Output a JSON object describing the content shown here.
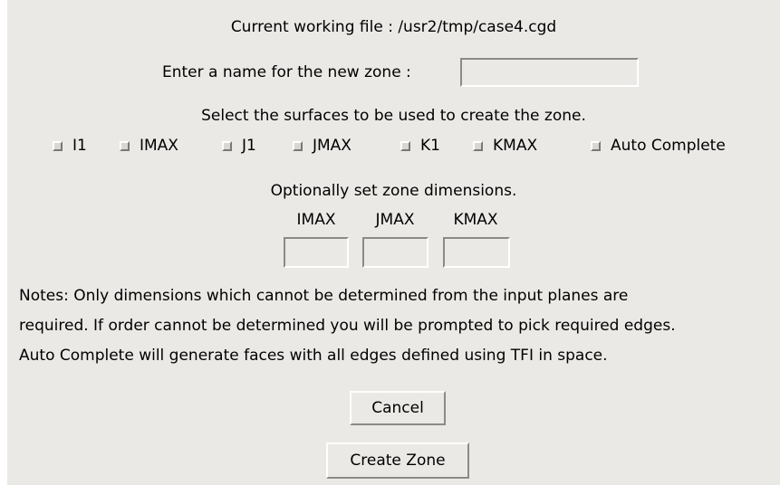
{
  "working_file": {
    "text": "Current working file : /usr2/tmp/case4.cgd"
  },
  "zone_name": {
    "label": "Enter a name for the new zone :",
    "value": ""
  },
  "surfaces": {
    "prompt": "Select the surfaces to be used to create the zone.",
    "options": [
      {
        "label": "I1",
        "checked": false
      },
      {
        "label": "IMAX",
        "checked": false
      },
      {
        "label": "J1",
        "checked": false
      },
      {
        "label": "JMAX",
        "checked": false
      },
      {
        "label": "K1",
        "checked": false
      },
      {
        "label": "KMAX",
        "checked": false
      },
      {
        "label": "Auto Complete",
        "checked": false
      }
    ]
  },
  "dimensions": {
    "prompt": "Optionally set zone dimensions.",
    "labels": [
      "IMAX",
      "JMAX",
      "KMAX"
    ],
    "values": [
      "",
      "",
      ""
    ]
  },
  "notes": [
    "Notes: Only dimensions which cannot be determined from the input planes are",
    "required. If order cannot be determined you will be prompted to pick required edges.",
    "Auto Complete will generate faces with all edges defined using TFI in space."
  ],
  "buttons": {
    "cancel": "Cancel",
    "create": "Create Zone"
  }
}
